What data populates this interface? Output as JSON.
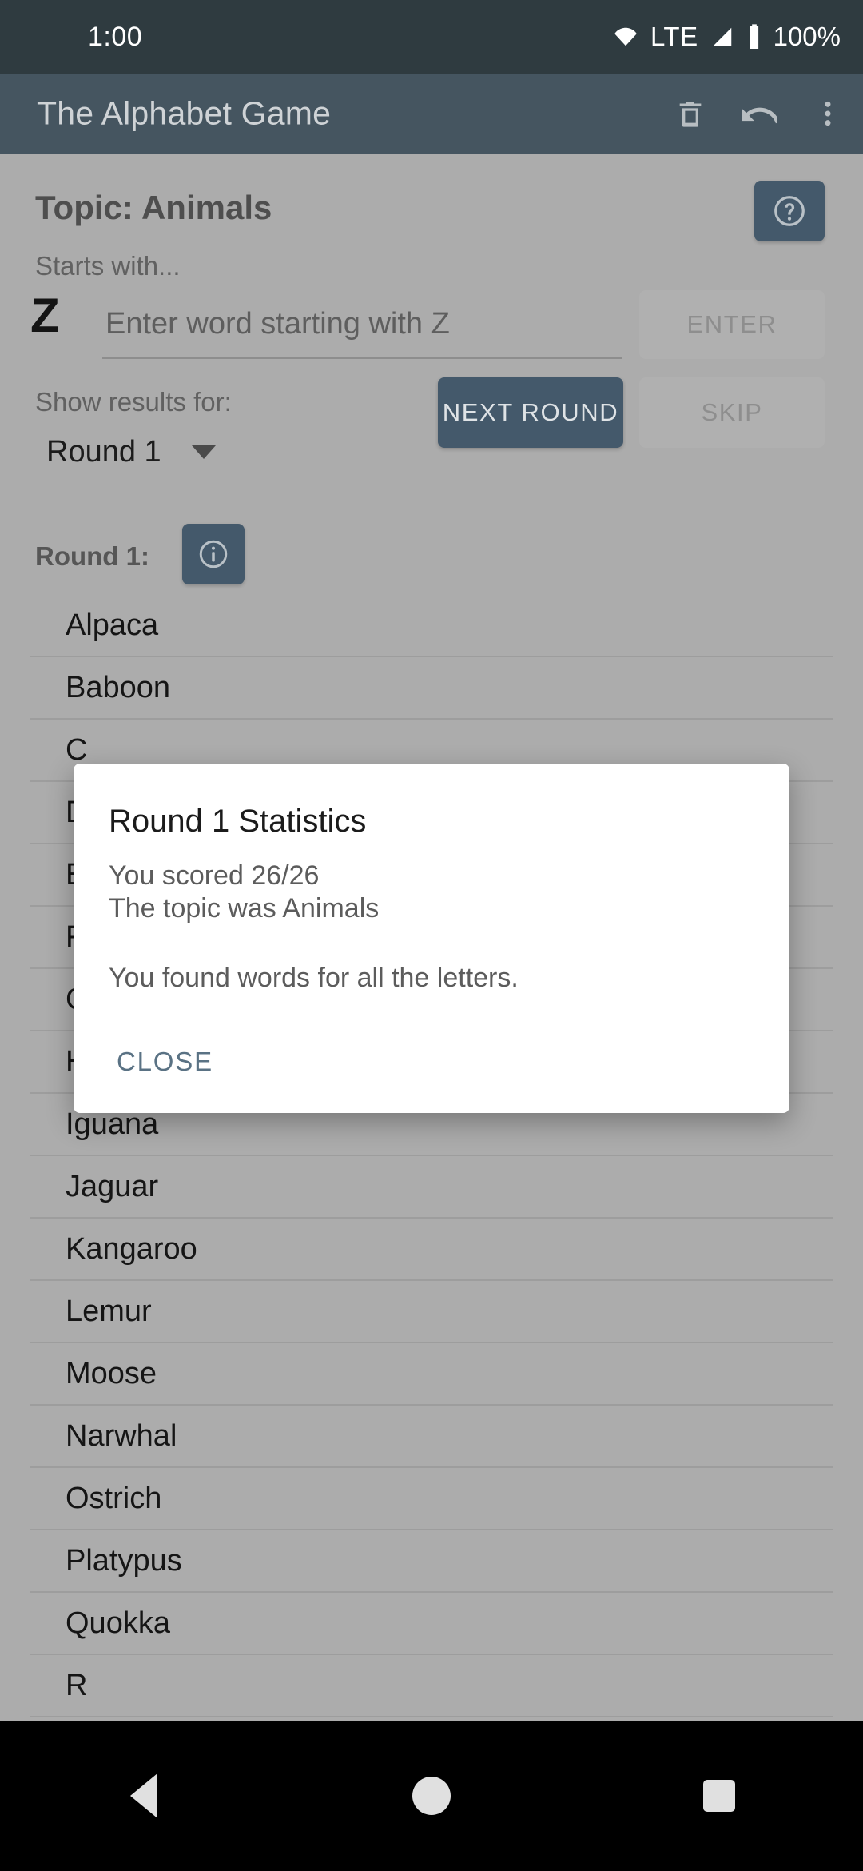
{
  "status_bar": {
    "time": "1:00",
    "network_label": "LTE",
    "battery_label": "100%",
    "icons": [
      "wifi-icon",
      "signal-icon",
      "battery-icon"
    ]
  },
  "toolbar": {
    "title": "The Alphabet Game",
    "actions": [
      {
        "name": "delete-icon",
        "label": "Delete"
      },
      {
        "name": "undo-icon",
        "label": "Undo"
      },
      {
        "name": "overflow-menu-icon",
        "label": "More options"
      }
    ]
  },
  "game": {
    "topic_label": "Topic: Animals",
    "help_button_label": "?",
    "starts_with_label": "Starts with...",
    "current_letter": "Z",
    "input_placeholder": "Enter word starting with Z",
    "input_value": "",
    "enter_button": "ENTER",
    "next_round_button": "NEXT ROUND",
    "skip_button": "SKIP",
    "show_results_label": "Show results for:",
    "round_selected": "Round 1",
    "round_options": [
      "Round 1"
    ],
    "round_heading": "Round 1:",
    "info_button_label": "i"
  },
  "word_list": [
    {
      "text": "Alpaca",
      "hidden_by_dialog": false
    },
    {
      "text": "Baboon",
      "hidden_by_dialog": false
    },
    {
      "text": "C",
      "hidden_by_dialog": true
    },
    {
      "text": "D",
      "hidden_by_dialog": true
    },
    {
      "text": "E",
      "hidden_by_dialog": true
    },
    {
      "text": "F",
      "hidden_by_dialog": true
    },
    {
      "text": "G",
      "hidden_by_dialog": true
    },
    {
      "text": "Hyena",
      "hidden_by_dialog": false
    },
    {
      "text": "Iguana",
      "hidden_by_dialog": false
    },
    {
      "text": "Jaguar",
      "hidden_by_dialog": false
    },
    {
      "text": "Kangaroo",
      "hidden_by_dialog": false
    },
    {
      "text": "Lemur",
      "hidden_by_dialog": false
    },
    {
      "text": "Moose",
      "hidden_by_dialog": false
    },
    {
      "text": "Narwhal",
      "hidden_by_dialog": false
    },
    {
      "text": "Ostrich",
      "hidden_by_dialog": false
    },
    {
      "text": "Platypus",
      "hidden_by_dialog": false
    },
    {
      "text": "Quokka",
      "hidden_by_dialog": false
    },
    {
      "text": "R",
      "hidden_by_dialog": false
    }
  ],
  "dialog": {
    "title": "Round 1 Statistics",
    "line1": "You scored 26/26",
    "line2": "The topic was Animals",
    "line3": "You found words for all the letters.",
    "close_button": "CLOSE"
  },
  "nav_bar": {
    "back": "back-icon",
    "home": "home-icon",
    "recents": "recents-icon"
  },
  "colors": {
    "status_bar": "#2f3b40",
    "toolbar": "#455560",
    "accent": "#44596b",
    "scrim_background": "#acacac",
    "dialog_background": "#ffffff",
    "close_link": "#5a7284"
  }
}
